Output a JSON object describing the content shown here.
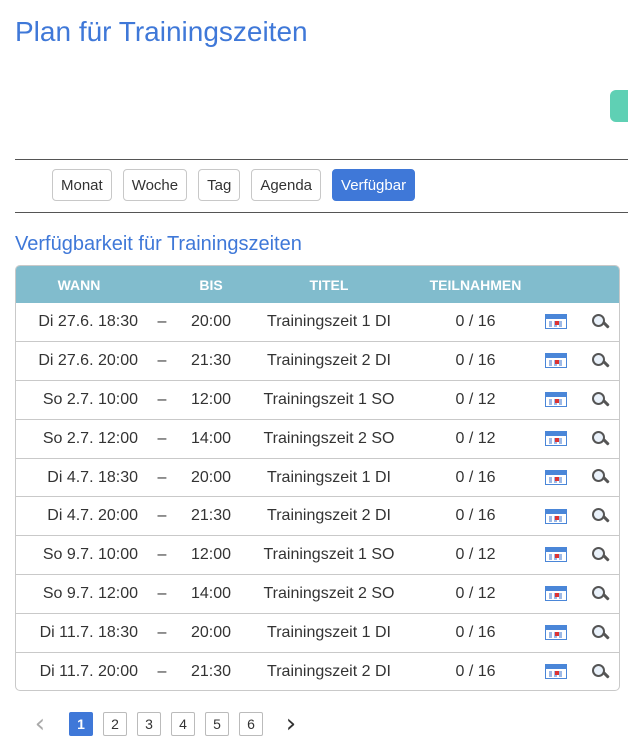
{
  "page": {
    "title": "Plan für Trainingszeiten"
  },
  "views": [
    {
      "label": "Monat",
      "active": false
    },
    {
      "label": "Woche",
      "active": false
    },
    {
      "label": "Tag",
      "active": false
    },
    {
      "label": "Agenda",
      "active": false
    },
    {
      "label": "Verfügbar",
      "active": true
    }
  ],
  "section": {
    "title": "Verfügbarkeit für Trainingszeiten"
  },
  "table": {
    "headers": [
      "WANN",
      "BIS",
      "TITEL",
      "TEILNAHMEN"
    ],
    "separator": "–",
    "rows": [
      {
        "from": "Di 27.6. 18:30",
        "to": "20:00",
        "title": "Trainingszeit 1 DI",
        "participation": "0 / 16"
      },
      {
        "from": "Di 27.6. 20:00",
        "to": "21:30",
        "title": "Trainingszeit 2 DI",
        "participation": "0 / 16"
      },
      {
        "from": "So 2.7. 10:00",
        "to": "12:00",
        "title": "Trainingszeit 1 SO",
        "participation": "0 / 12"
      },
      {
        "from": "So 2.7. 12:00",
        "to": "14:00",
        "title": "Trainingszeit 2 SO",
        "participation": "0 / 12"
      },
      {
        "from": "Di 4.7. 18:30",
        "to": "20:00",
        "title": "Trainingszeit 1 DI",
        "participation": "0 / 16"
      },
      {
        "from": "Di 4.7. 20:00",
        "to": "21:30",
        "title": "Trainingszeit 2 DI",
        "participation": "0 / 16"
      },
      {
        "from": "So 9.7. 10:00",
        "to": "12:00",
        "title": "Trainingszeit 1 SO",
        "participation": "0 / 12"
      },
      {
        "from": "So 9.7. 12:00",
        "to": "14:00",
        "title": "Trainingszeit 2 SO",
        "participation": "0 / 12"
      },
      {
        "from": "Di 11.7. 18:30",
        "to": "20:00",
        "title": "Trainingszeit 1 DI",
        "participation": "0 / 16"
      },
      {
        "from": "Di 11.7. 20:00",
        "to": "21:30",
        "title": "Trainingszeit 2 DI",
        "participation": "0 / 16"
      }
    ],
    "row_icons": [
      "calendar-icon",
      "magnifier-icon"
    ]
  },
  "pagination": {
    "prev": "‹",
    "next": "›",
    "pages": [
      "1",
      "2",
      "3",
      "4",
      "5",
      "6"
    ],
    "current": "1"
  },
  "colors": {
    "accent": "#3f78d8",
    "table_header": "#81bccd",
    "side_pill": "#5fd0b4"
  }
}
